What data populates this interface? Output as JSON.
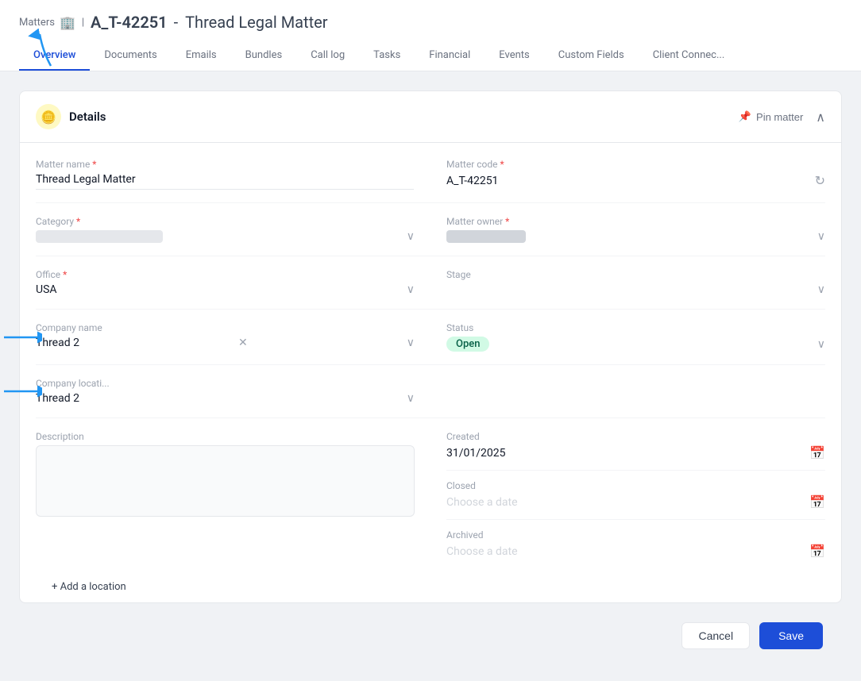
{
  "header": {
    "breadcrumb": "Matters",
    "matter_code": "A_T-42251",
    "separator": "-",
    "matter_name": "Thread Legal Matter",
    "title_full": "A_T-42251 - Thread Legal Matter"
  },
  "tabs": [
    {
      "label": "Overview",
      "active": true
    },
    {
      "label": "Documents",
      "active": false
    },
    {
      "label": "Emails",
      "active": false
    },
    {
      "label": "Bundles",
      "active": false
    },
    {
      "label": "Call log",
      "active": false
    },
    {
      "label": "Tasks",
      "active": false
    },
    {
      "label": "Financial",
      "active": false
    },
    {
      "label": "Events",
      "active": false
    },
    {
      "label": "Custom Fields",
      "active": false
    },
    {
      "label": "Client Connec...",
      "active": false
    }
  ],
  "details_card": {
    "title": "Details",
    "pin_matter_label": "Pin matter"
  },
  "form": {
    "matter_name_label": "Matter name",
    "matter_name_value": "Thread Legal Matter",
    "matter_code_label": "Matter code",
    "matter_code_value": "A_T-42251",
    "category_label": "Category",
    "matter_owner_label": "Matter owner",
    "office_label": "Office",
    "office_value": "USA",
    "stage_label": "Stage",
    "company_name_label": "Company name",
    "company_name_value": "Thread 2",
    "status_label": "Status",
    "status_value": "Open",
    "company_location_label": "Company locati...",
    "company_location_value": "Thread 2",
    "description_label": "Description",
    "created_label": "Created",
    "created_value": "31/01/2025",
    "closed_label": "Closed",
    "closed_placeholder": "Choose a date",
    "archived_label": "Archived",
    "archived_placeholder": "Choose a date",
    "add_location_label": "+ Add a location"
  },
  "footer": {
    "cancel_label": "Cancel",
    "save_label": "Save"
  }
}
